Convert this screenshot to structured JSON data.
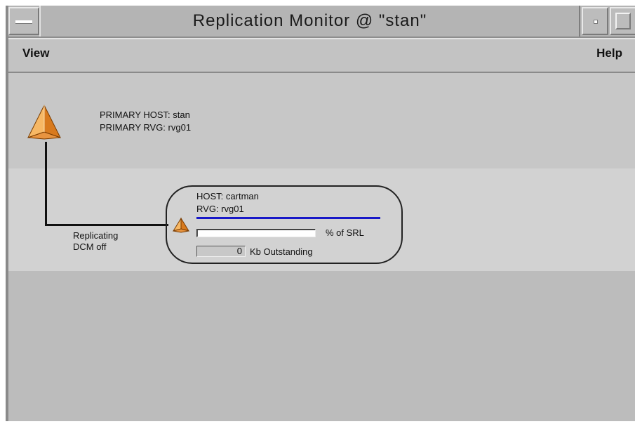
{
  "window": {
    "title": "Replication Monitor @ \"stan\""
  },
  "menubar": {
    "left_label": "View",
    "right_label": "Help"
  },
  "primary": {
    "host_line": "PRIMARY HOST: stan",
    "rvg_line": "PRIMARY RVG: rvg01",
    "icon": "pyramid-icon"
  },
  "link": {
    "status_line_1": "Replicating",
    "status_line_2": "DCM off"
  },
  "secondary": {
    "host_line": "HOST: cartman",
    "rvg_line": "RVG: rvg01",
    "icon": "pyramid-icon",
    "srl_percent": 0,
    "srl_label": "% of SRL",
    "outstanding_value": "0",
    "outstanding_label": "Kb Outstanding"
  },
  "colors": {
    "window_bg": "#c3c3c3",
    "secondary_band": "#d2d2d2",
    "accent_blue": "#1818c8",
    "pyramid_light": "#f4b05a",
    "pyramid_dark": "#d4761e"
  }
}
